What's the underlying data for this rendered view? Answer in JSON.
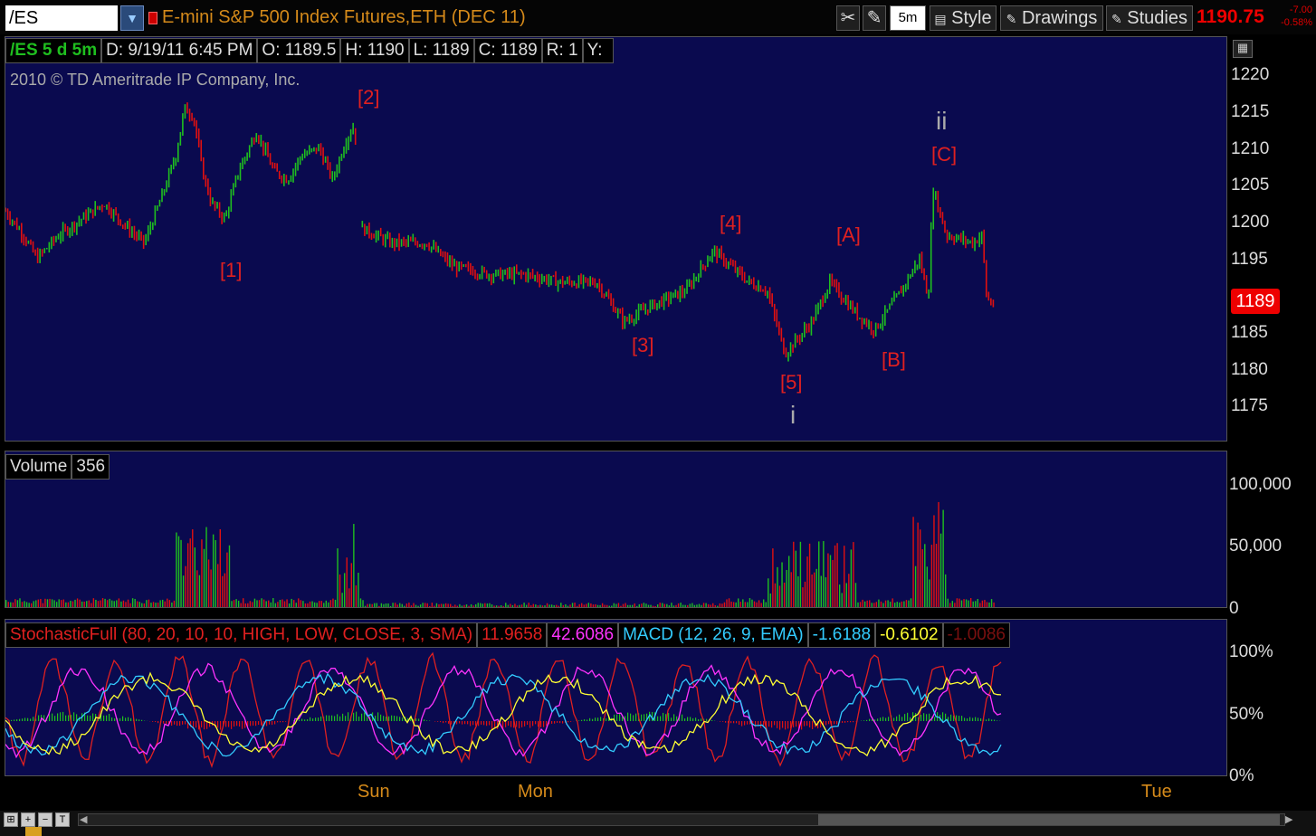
{
  "toolbar": {
    "symbol": "/ES",
    "description": "E-mini S&P 500 Index Futures,ETH (DEC 11)",
    "aggregation": "5m",
    "style_label": "Style",
    "drawings_label": "Drawings",
    "studies_label": "Studies",
    "last_price": "1190.75",
    "change": "-7.00",
    "change_pct": "-0.58%"
  },
  "price_panel": {
    "header": {
      "symbol_period": "/ES 5 d 5m",
      "date": "D: 9/19/11 6:45 PM",
      "open": "O: 1189.5",
      "high": "H: 1190",
      "low": "L: 1189",
      "close": "C: 1189",
      "range": "R: 1",
      "yield": "Y:"
    },
    "copyright": "2010 © TD Ameritrade IP Company, Inc.",
    "current_price_tag": "1189",
    "y_ticks": [
      "1220",
      "1215",
      "1210",
      "1205",
      "1200",
      "1195",
      "1185",
      "1180",
      "1175"
    ],
    "wave_labels": [
      "[2]",
      "[1]",
      "[3]",
      "[4]",
      "[5]",
      "i",
      "[A]",
      "[B]",
      "[C]",
      "ii"
    ]
  },
  "volume_panel": {
    "label": "Volume",
    "value": "356",
    "y_ticks": [
      "100,000",
      "50,000",
      "0"
    ]
  },
  "indicator_panel": {
    "stoch_label": "StochasticFull (80, 20, 10, 10, HIGH, LOW, CLOSE, 3, SMA)",
    "stoch_k": "11.9658",
    "stoch_d": "42.6086",
    "macd_label": "MACD (12, 26, 9, EMA)",
    "macd_value": "-1.6188",
    "macd_avg": "-0.6102",
    "macd_diff": "-1.0086",
    "y_ticks": [
      "100%",
      "50%",
      "0%"
    ]
  },
  "x_axis": [
    "Sun",
    "Mon",
    "Tue"
  ],
  "colors": {
    "up": "#1fbf1f",
    "down": "#e01010",
    "panel_bg": "#0a0a4f",
    "axis_text": "#d58a1a"
  },
  "chart_data": {
    "type": "line",
    "title": "/ES 5 d 5m",
    "y_range": [
      1172,
      1223
    ],
    "price_path": [
      {
        "x": 0,
        "y": 1201
      },
      {
        "x": 0.02,
        "y": 1198
      },
      {
        "x": 0.035,
        "y": 1195
      },
      {
        "x": 0.06,
        "y": 1198
      },
      {
        "x": 0.085,
        "y": 1200
      },
      {
        "x": 0.11,
        "y": 1202
      },
      {
        "x": 0.135,
        "y": 1199
      },
      {
        "x": 0.155,
        "y": 1197
      },
      {
        "x": 0.175,
        "y": 1203
      },
      {
        "x": 0.19,
        "y": 1208
      },
      {
        "x": 0.2,
        "y": 1214
      },
      {
        "x": 0.21,
        "y": 1213
      },
      {
        "x": 0.22,
        "y": 1206
      },
      {
        "x": 0.23,
        "y": 1202
      },
      {
        "x": 0.245,
        "y": 1200
      },
      {
        "x": 0.26,
        "y": 1206
      },
      {
        "x": 0.28,
        "y": 1211
      },
      {
        "x": 0.3,
        "y": 1206
      },
      {
        "x": 0.315,
        "y": 1205
      },
      {
        "x": 0.33,
        "y": 1208
      },
      {
        "x": 0.35,
        "y": 1209
      },
      {
        "x": 0.365,
        "y": 1205
      },
      {
        "x": 0.38,
        "y": 1210
      },
      {
        "x": 0.39,
        "y": 1212
      },
      {
        "x": 0.395,
        "y": 1199
      },
      {
        "x": 0.43,
        "y": 1197
      },
      {
        "x": 0.47,
        "y": 1197
      },
      {
        "x": 0.5,
        "y": 1194
      },
      {
        "x": 0.54,
        "y": 1193
      },
      {
        "x": 0.58,
        "y": 1193
      },
      {
        "x": 0.62,
        "y": 1192
      },
      {
        "x": 0.66,
        "y": 1192
      },
      {
        "x": 0.69,
        "y": 1187
      },
      {
        "x": 0.72,
        "y": 1189
      },
      {
        "x": 0.76,
        "y": 1191
      },
      {
        "x": 0.79,
        "y": 1196
      },
      {
        "x": 0.83,
        "y": 1192
      },
      {
        "x": 0.85,
        "y": 1191
      },
      {
        "x": 0.87,
        "y": 1183
      },
      {
        "x": 0.9,
        "y": 1187
      },
      {
        "x": 0.92,
        "y": 1192
      },
      {
        "x": 0.95,
        "y": 1188
      },
      {
        "x": 0.97,
        "y": 1186
      },
      {
        "x": 1.0,
        "y": 1191
      },
      {
        "x": 1.02,
        "y": 1195
      },
      {
        "x": 1.03,
        "y": 1190
      },
      {
        "x": 1.035,
        "y": 1204
      },
      {
        "x": 1.05,
        "y": 1198
      },
      {
        "x": 1.08,
        "y": 1197
      },
      {
        "x": 1.09,
        "y": 1198
      },
      {
        "x": 1.095,
        "y": 1190
      },
      {
        "x": 1.105,
        "y": 1189
      }
    ]
  }
}
